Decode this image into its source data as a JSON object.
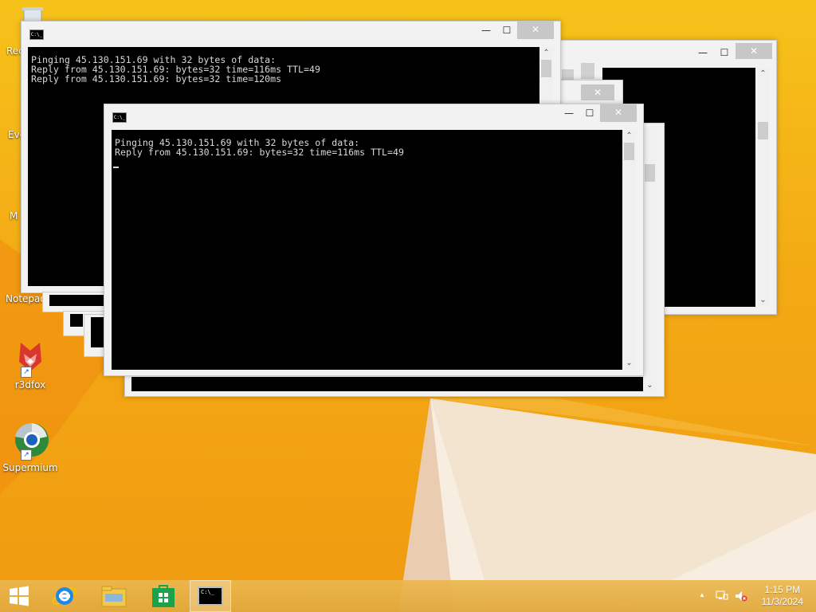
{
  "desktop": {
    "icons": [
      {
        "name": "recycle-bin",
        "label": "Rec"
      },
      {
        "name": "everything",
        "label": "Eve"
      },
      {
        "name": "media",
        "label": "M"
      },
      {
        "name": "notepad",
        "label": "Notepad"
      },
      {
        "name": "r3dfox",
        "label": "r3dfox"
      },
      {
        "name": "supermium",
        "label": "Supermium"
      }
    ]
  },
  "windows": {
    "control_labels": {
      "minimize": "—",
      "maximize": "☐",
      "close": "✕"
    },
    "sysicon_text": "C:\\_",
    "console_back": {
      "lines": "Pinging 45.130.151.69 with 32 bytes of data:\nReply from 45.130.151.69: bytes=32 time=116ms TTL=49\nReply from 45.130.151.69: bytes=32 time=120ms"
    },
    "console_front": {
      "lines": "Pinging 45.130.151.69 with 32 bytes of data:\nReply from 45.130.151.69: bytes=32 time=116ms TTL=49"
    }
  },
  "taskbar": {
    "apps": [
      {
        "name": "start",
        "icon": "windows-logo-icon"
      },
      {
        "name": "internet-explorer",
        "icon": "ie-icon"
      },
      {
        "name": "file-explorer",
        "icon": "folder-icon"
      },
      {
        "name": "store",
        "icon": "store-icon"
      },
      {
        "name": "command-prompt",
        "icon": "cmd-icon",
        "active": true,
        "icon_text": "C:\\_"
      }
    ],
    "tray": {
      "show_hidden": "▲",
      "time": "1:15 PM",
      "date": "11/3/2024"
    }
  },
  "colors": {
    "wallpaper": "#f3aa14",
    "console_bg": "#000000",
    "console_fg": "#d8d8d8"
  }
}
